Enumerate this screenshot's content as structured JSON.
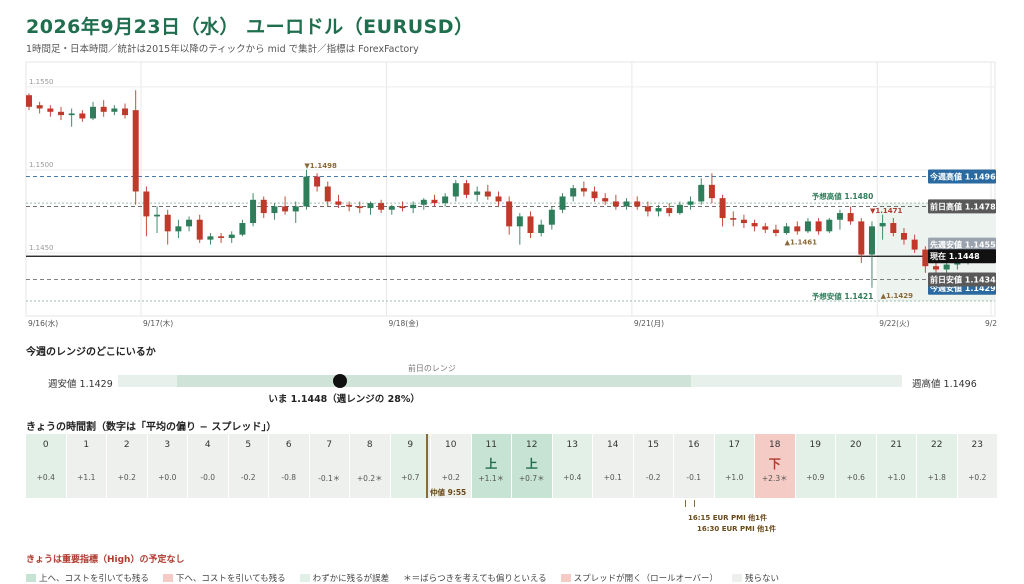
{
  "header": {
    "title": "2026年9月23日（水） ユーロドル（EURUSD）",
    "subtitle": "1時間足・日本時間／統計は2015年以降のティックから mid で集計／指標は ForexFactory"
  },
  "colors": {
    "up": "#2e7d5b",
    "down": "#c0392b",
    "accent": "#1f6e4e",
    "level_blue": "#2a6aa0",
    "level_gray": "#595959",
    "level_pale": "#9aa3ad",
    "forecast": "#2f7d5b"
  },
  "chart_data": {
    "type": "candlestick",
    "ylim": [
      1.1412,
      1.1565
    ],
    "y_ticks": [
      "1.1550",
      "1.1500",
      "1.1450"
    ],
    "x_labels": [
      "9/16(水)",
      "9/17(木)",
      "9/18(金)",
      "9/21(月)",
      "9/22(火)",
      "9/2"
    ],
    "candles": [
      [
        1.1545,
        1.1546,
        1.1536,
        1.1538
      ],
      [
        1.1539,
        1.1541,
        1.1534,
        1.1537
      ],
      [
        1.1537,
        1.1539,
        1.1532,
        1.1535
      ],
      [
        1.1535,
        1.1538,
        1.153,
        1.1533
      ],
      [
        1.1533,
        1.1537,
        1.1526,
        1.1534
      ],
      [
        1.1534,
        1.1536,
        1.1529,
        1.1531
      ],
      [
        1.1531,
        1.1541,
        1.153,
        1.1538
      ],
      [
        1.1538,
        1.1542,
        1.1532,
        1.1535
      ],
      [
        1.1535,
        1.1539,
        1.1533,
        1.1537
      ],
      [
        1.1537,
        1.154,
        1.1531,
        1.1533
      ],
      [
        1.1536,
        1.1548,
        1.1479,
        1.1487
      ],
      [
        1.1487,
        1.149,
        1.146,
        1.1472
      ],
      [
        1.1472,
        1.1478,
        1.1462,
        1.1473
      ],
      [
        1.1473,
        1.1476,
        1.1455,
        1.1463
      ],
      [
        1.1463,
        1.147,
        1.1459,
        1.1466
      ],
      [
        1.1466,
        1.1472,
        1.1463,
        1.147
      ],
      [
        1.147,
        1.1473,
        1.1456,
        1.1458
      ],
      [
        1.1458,
        1.1462,
        1.1455,
        1.146
      ],
      [
        1.146,
        1.1462,
        1.1456,
        1.1459
      ],
      [
        1.1459,
        1.1463,
        1.1456,
        1.1461
      ],
      [
        1.1461,
        1.147,
        1.146,
        1.1468
      ],
      [
        1.1468,
        1.1486,
        1.1466,
        1.1482
      ],
      [
        1.1482,
        1.1484,
        1.1471,
        1.1474
      ],
      [
        1.1474,
        1.148,
        1.147,
        1.1478
      ],
      [
        1.1478,
        1.1484,
        1.1473,
        1.1475
      ],
      [
        1.1475,
        1.1481,
        1.1468,
        1.1478
      ],
      [
        1.1478,
        1.15,
        1.1476,
        1.1496
      ],
      [
        1.1496,
        1.1498,
        1.1487,
        1.149
      ],
      [
        1.149,
        1.1493,
        1.1478,
        1.1481
      ],
      [
        1.1481,
        1.1485,
        1.1477,
        1.1479
      ],
      [
        1.1479,
        1.1481,
        1.1475,
        1.1478
      ],
      [
        1.1478,
        1.1481,
        1.1474,
        1.1477
      ],
      [
        1.1477,
        1.1481,
        1.1473,
        1.148
      ],
      [
        1.148,
        1.1482,
        1.1474,
        1.1476
      ],
      [
        1.1476,
        1.1479,
        1.1473,
        1.1478
      ],
      [
        1.1478,
        1.1481,
        1.1475,
        1.1477
      ],
      [
        1.1477,
        1.1481,
        1.1474,
        1.1479
      ],
      [
        1.1479,
        1.1483,
        1.1476,
        1.1482
      ],
      [
        1.1482,
        1.1485,
        1.1478,
        1.148
      ],
      [
        1.148,
        1.1486,
        1.1478,
        1.1484
      ],
      [
        1.1484,
        1.1494,
        1.1481,
        1.1492
      ],
      [
        1.1492,
        1.1494,
        1.1483,
        1.1485
      ],
      [
        1.1485,
        1.149,
        1.1481,
        1.1487
      ],
      [
        1.1487,
        1.1491,
        1.1482,
        1.1484
      ],
      [
        1.1484,
        1.1487,
        1.1478,
        1.1481
      ],
      [
        1.1481,
        1.1484,
        1.1461,
        1.1466
      ],
      [
        1.1466,
        1.1474,
        1.1455,
        1.1472
      ],
      [
        1.1472,
        1.1475,
        1.1459,
        1.1462
      ],
      [
        1.1462,
        1.147,
        1.146,
        1.1467
      ],
      [
        1.1467,
        1.1478,
        1.1464,
        1.1476
      ],
      [
        1.1476,
        1.1486,
        1.1474,
        1.1484
      ],
      [
        1.1484,
        1.1491,
        1.1481,
        1.1489
      ],
      [
        1.1489,
        1.1493,
        1.1484,
        1.1487
      ],
      [
        1.1487,
        1.149,
        1.1481,
        1.1483
      ],
      [
        1.1483,
        1.1486,
        1.1479,
        1.1481
      ],
      [
        1.1481,
        1.1485,
        1.1476,
        1.1478
      ],
      [
        1.1478,
        1.1483,
        1.1476,
        1.1481
      ],
      [
        1.1481,
        1.1484,
        1.1476,
        1.1478
      ],
      [
        1.1478,
        1.1481,
        1.1472,
        1.1475
      ],
      [
        1.1475,
        1.1479,
        1.1472,
        1.1477
      ],
      [
        1.1477,
        1.148,
        1.1472,
        1.1474
      ],
      [
        1.1474,
        1.1481,
        1.1473,
        1.1479
      ],
      [
        1.1479,
        1.1484,
        1.1476,
        1.1481
      ],
      [
        1.1481,
        1.1495,
        1.1479,
        1.1491
      ],
      [
        1.1491,
        1.1498,
        1.148,
        1.1483
      ],
      [
        1.1483,
        1.1485,
        1.1466,
        1.1471
      ],
      [
        1.1471,
        1.1475,
        1.1466,
        1.147
      ],
      [
        1.147,
        1.1473,
        1.1465,
        1.1468
      ],
      [
        1.1468,
        1.147,
        1.1463,
        1.1466
      ],
      [
        1.1466,
        1.1468,
        1.1462,
        1.1464
      ],
      [
        1.1464,
        1.1467,
        1.146,
        1.1462
      ],
      [
        1.1462,
        1.1468,
        1.1461,
        1.1466
      ],
      [
        1.1466,
        1.1469,
        1.1461,
        1.1463
      ],
      [
        1.1463,
        1.1471,
        1.1462,
        1.1469
      ],
      [
        1.1469,
        1.1471,
        1.1461,
        1.1463
      ],
      [
        1.1463,
        1.1471,
        1.1462,
        1.147
      ],
      [
        1.147,
        1.1476,
        1.1464,
        1.1474
      ],
      [
        1.1474,
        1.1478,
        1.1467,
        1.1469
      ],
      [
        1.1469,
        1.1471,
        1.1444,
        1.1449
      ],
      [
        1.1449,
        1.1469,
        1.1429,
        1.1466
      ],
      [
        1.1466,
        1.1473,
        1.1458,
        1.1468
      ],
      [
        1.1468,
        1.1471,
        1.146,
        1.1462
      ],
      [
        1.1462,
        1.1465,
        1.1455,
        1.1458
      ],
      [
        1.1458,
        1.1461,
        1.145,
        1.1452
      ],
      [
        1.1452,
        1.1454,
        1.1438,
        1.1442
      ],
      [
        1.1442,
        1.1447,
        1.1435,
        1.144
      ],
      [
        1.144,
        1.1445,
        1.1436,
        1.1443
      ],
      [
        1.1443,
        1.1449,
        1.144,
        1.1446
      ],
      [
        1.1446,
        1.1452,
        1.1443,
        1.1448
      ]
    ],
    "levels": [
      {
        "name": "prev_week_low",
        "label": "先週安値 1.1455",
        "value": 1.1455,
        "color": "#9aa3ad",
        "style": "none"
      },
      {
        "name": "week_high",
        "label": "今週高値 1.1496",
        "value": 1.1496,
        "color": "#2a6aa0",
        "style": "dash"
      },
      {
        "name": "prev_day_high",
        "label": "前日高値 1.1478",
        "value": 1.1478,
        "color": "#595959",
        "style": "dash"
      },
      {
        "name": "week_low",
        "label": "今週安値 1.1429",
        "value": 1.1429,
        "color": "#2a6aa0",
        "style": "none"
      },
      {
        "name": "current",
        "label": "現在 1.1448",
        "value": 1.1448,
        "color": "#111111",
        "style": "solid"
      },
      {
        "name": "prev_day_low",
        "label": "前日安値 1.1434",
        "value": 1.1434,
        "color": "#595959",
        "style": "dash"
      }
    ],
    "forecast": {
      "high_label": "予想高値 1.1480",
      "high": 1.148,
      "low_label": "予想安値 1.1421",
      "low": 1.1421,
      "start_index": 80
    },
    "annotations": [
      {
        "text": "▼1.1498",
        "index": 26,
        "value": 1.1498,
        "pos": "above",
        "color": "#8a6a3a"
      },
      {
        "text": "▲1.1461",
        "index": 71,
        "value": 1.1461,
        "pos": "below",
        "color": "#8a6a3a"
      },
      {
        "text": "▼1.1471",
        "index": 79,
        "value": 1.1471,
        "pos": "above",
        "color": "#b03a2e"
      },
      {
        "text": "▲1.1429",
        "index": 80,
        "value": 1.1429,
        "pos": "below",
        "color": "#8a6a3a"
      }
    ]
  },
  "range": {
    "section_title": "今週のレンジのどこにいるか",
    "low_label": "週安値 1.1429",
    "high_label": "週高値 1.1496",
    "low": 1.1429,
    "high": 1.1496,
    "prev_low": 1.1434,
    "prev_high": 1.1478,
    "current": 1.1448,
    "prev_label": "前日のレンジ",
    "now_label": "いま 1.1448（週レンジの 28%）"
  },
  "hours": {
    "section_title": "きょうの時間割（数字は「平均の偏り − スプレッド」）",
    "items": [
      {
        "h": "0",
        "v": "+0.4",
        "s": "",
        "k": "weak"
      },
      {
        "h": "1",
        "v": "+1.1",
        "s": "",
        "k": "none"
      },
      {
        "h": "2",
        "v": "+0.2",
        "s": "",
        "k": "none"
      },
      {
        "h": "3",
        "v": "+0.0",
        "s": "",
        "k": "none"
      },
      {
        "h": "4",
        "v": "-0.0",
        "s": "",
        "k": "none"
      },
      {
        "h": "5",
        "v": "-0.2",
        "s": "",
        "k": "none"
      },
      {
        "h": "6",
        "v": "-0.8",
        "s": "",
        "k": "none"
      },
      {
        "h": "7",
        "v": "-0.1＊",
        "s": "",
        "k": "none"
      },
      {
        "h": "8",
        "v": "+0.2＊",
        "s": "",
        "k": "none"
      },
      {
        "h": "9",
        "v": "+0.7",
        "s": "",
        "k": "weak"
      },
      {
        "h": "10",
        "v": "+0.2",
        "s": "",
        "k": "none"
      },
      {
        "h": "11",
        "v": "+1.1＊",
        "s": "上",
        "k": "up"
      },
      {
        "h": "12",
        "v": "+0.7＊",
        "s": "上",
        "k": "up"
      },
      {
        "h": "13",
        "v": "+0.4",
        "s": "",
        "k": "weak"
      },
      {
        "h": "14",
        "v": "+0.1",
        "s": "",
        "k": "none"
      },
      {
        "h": "15",
        "v": "-0.2",
        "s": "",
        "k": "none"
      },
      {
        "h": "16",
        "v": "-0.1",
        "s": "",
        "k": "none"
      },
      {
        "h": "17",
        "v": "+1.0",
        "s": "",
        "k": "weak"
      },
      {
        "h": "18",
        "v": "+2.3＊",
        "s": "下",
        "k": "down"
      },
      {
        "h": "19",
        "v": "+0.9",
        "s": "",
        "k": "weak"
      },
      {
        "h": "20",
        "v": "+0.6",
        "s": "",
        "k": "weak"
      },
      {
        "h": "21",
        "v": "+1.0",
        "s": "",
        "k": "weak"
      },
      {
        "h": "22",
        "v": "+1.8",
        "s": "",
        "k": "weak"
      },
      {
        "h": "23",
        "v": "+0.2",
        "s": "",
        "k": "none"
      }
    ],
    "opening_label": "仲値 9:55",
    "events": [
      "16:15 EUR PMI 他1件",
      "16:30 EUR PMI 他1件"
    ],
    "kind_colors": {
      "up": "#c6e3d3",
      "down": "#f4cbc5",
      "weak": "#e3f0e8",
      "none": "#eef0ee"
    },
    "up_text_color": "#1f6e4e",
    "down_text_color": "#b03a2e"
  },
  "notice": "きょうは重要指標（High）の予定なし",
  "legend": [
    {
      "label": "上へ、コストを引いても残る",
      "color": "#c6e3d3"
    },
    {
      "label": "下へ、コストを引いても残る",
      "color": "#f4cbc5"
    },
    {
      "label": "わずかに残るが誤差",
      "color": "#e3f0e8"
    },
    {
      "label": "＊＝ばらつきを考えても偏りといえる",
      "color": ""
    },
    {
      "label": "スプレッドが開く（ロールオーバー）",
      "color": "#f4cbc5"
    },
    {
      "label": "残らない",
      "color": "#eef0ee"
    }
  ]
}
